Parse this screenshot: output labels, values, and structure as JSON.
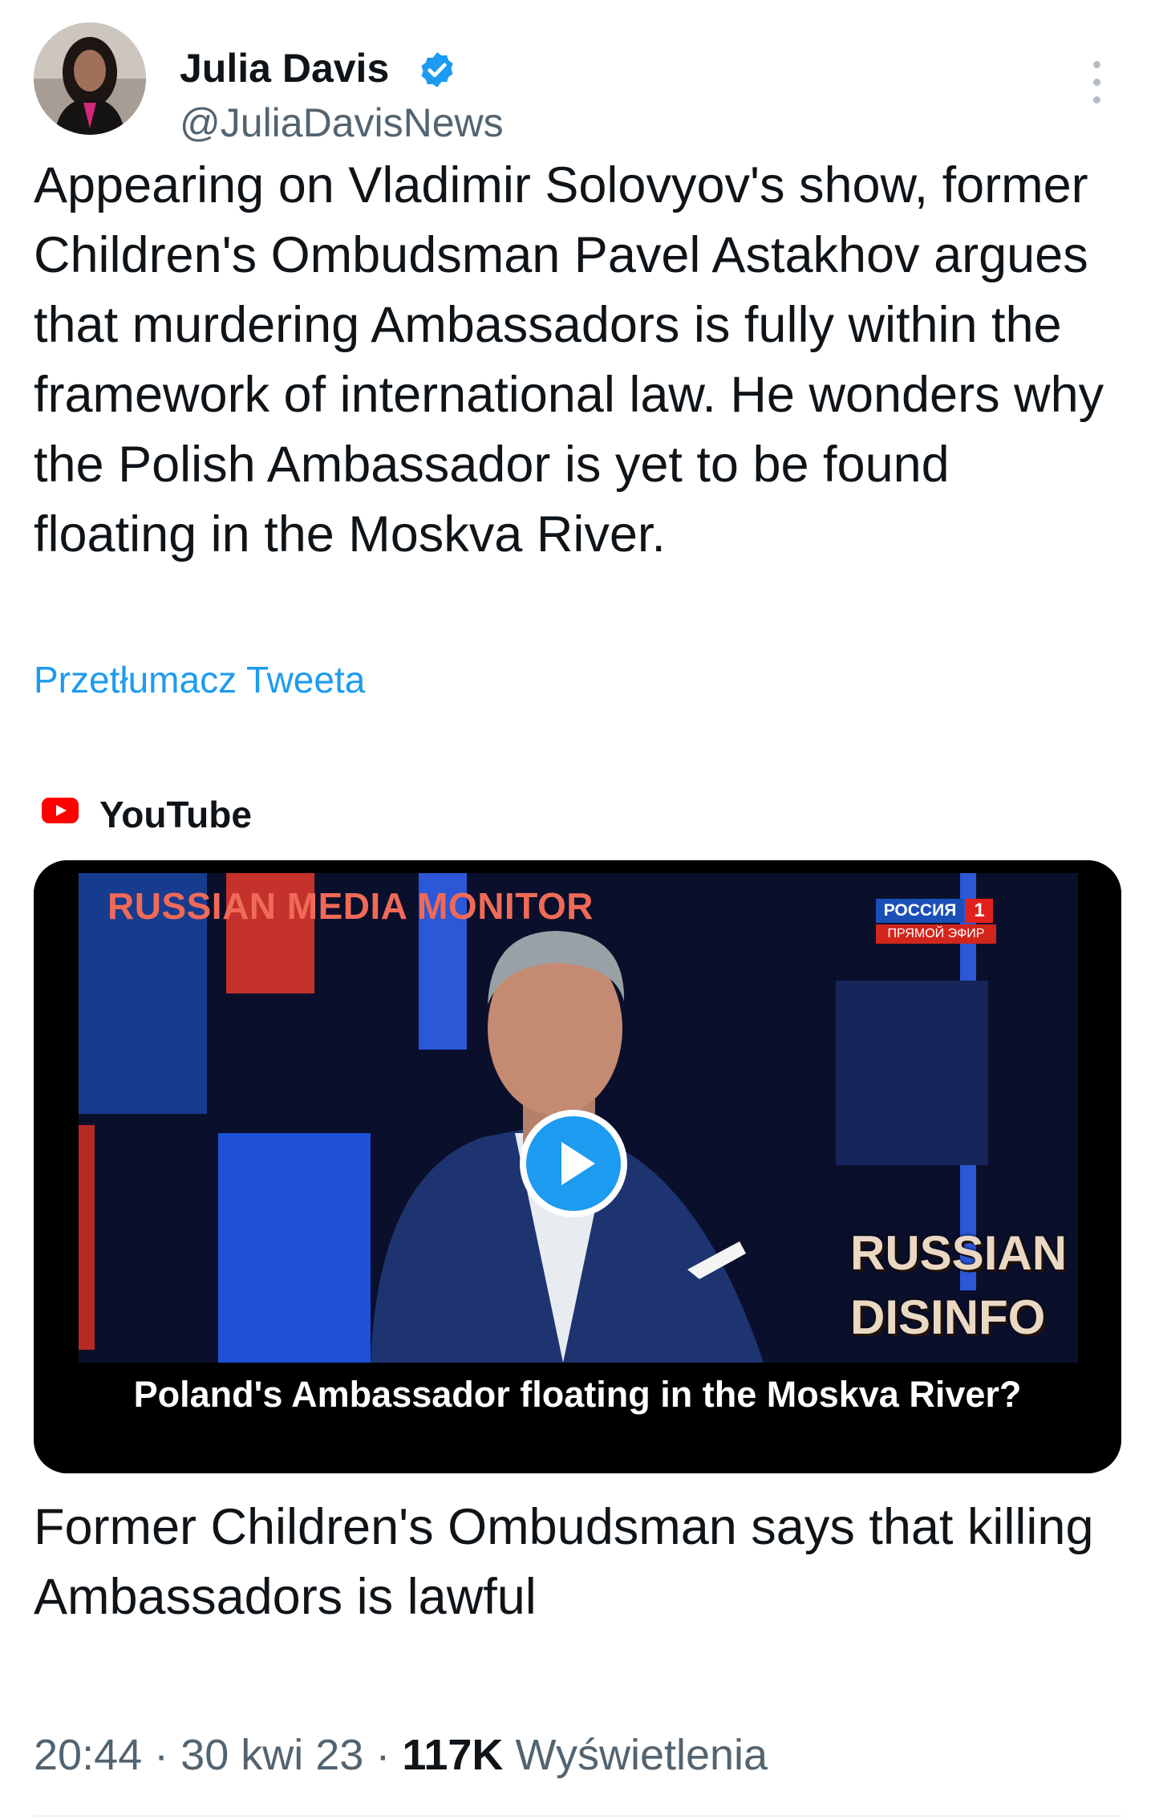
{
  "author": {
    "name": "Julia Davis",
    "handle": "@JuliaDavisNews",
    "verified": true,
    "avatar_icon": "profile-photo"
  },
  "tweet": {
    "text": "Appearing on Vladimir Solovyov's show, former Children's Ombudsman Pavel Astakhov argues that murdering Ambassadors is fully within the framework of international law. He wonders why the Polish Ambassador is yet to be found floating in the Moskva River.",
    "translate_label": "Przetłumacz Tweeta"
  },
  "card": {
    "source": "YouTube",
    "source_icon": "youtube-icon",
    "thumbnail": {
      "overlay_title": "RUSSIAN MEDIA MONITOR",
      "channel_badge_top": "РОССИЯ",
      "channel_badge_number": "1",
      "channel_badge_bottom": "ПРЯМОЙ ЭФИР",
      "disinfo_line1": "RUSSIAN",
      "disinfo_line2": "DISINFO",
      "caption": "Poland's Ambassador floating in the Moskva River?"
    },
    "play_icon": "play-icon",
    "link_title": "Former Children's Ombudsman says that killing Ambassadors is lawful"
  },
  "meta": {
    "time": "20:44",
    "date": "30 kwi 23",
    "views_count": "117K",
    "views_label": "Wyświetlenia",
    "separator": "·"
  },
  "colors": {
    "accent": "#1d9bf0",
    "text": "#0f1419",
    "secondary": "#536471",
    "youtube_red": "#ff0000"
  }
}
